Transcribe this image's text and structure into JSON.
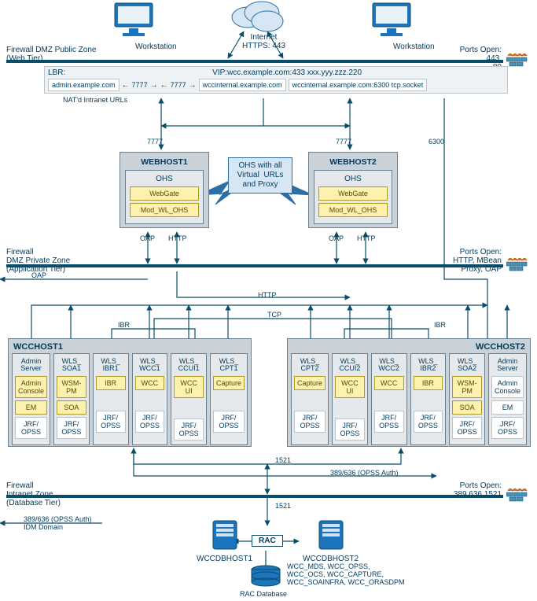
{
  "internet": {
    "label": "Internet",
    "protocol": "HTTPS: 443"
  },
  "workstation_left": "Workstation",
  "workstation_right": "Workstation",
  "fw1": {
    "left_label": "Firewall DMZ Public Zone\n(Web Tier)",
    "right_label": "Ports Open:\n443,\n80"
  },
  "lbr": {
    "prefix": "LBR:",
    "vip": "VIP:wcc.example.com:433  xxx.yyy.zzz.220",
    "url1": "admin.example.com",
    "url2": "wccinternal.example.com",
    "url3": "wccinternal.example.com:6300 tcp.socket",
    "nat": "NAT'd Intranet URLs",
    "p7777_a": "7777",
    "p7777_b": "7777"
  },
  "ports": {
    "p7777_l": "7777",
    "p7777_r": "7777",
    "p6300": "6300"
  },
  "ohs_center": "OHS with all\nVirtual  URLs\nand Proxy",
  "webhost1": {
    "title": "WEBHOST1",
    "ohs": "OHS",
    "webgate": "WebGate",
    "mod": "Mod_WL_OHS"
  },
  "webhost2": {
    "title": "WEBHOST2",
    "ohs": "OHS",
    "webgate": "WebGate",
    "mod": "Mod_WL_OHS"
  },
  "web_proto": {
    "oap1": "OAP",
    "http1": "HTTP",
    "oap2": "OAP",
    "http2": "HTTP"
  },
  "fw2": {
    "left_label": "Firewall\nDMZ Private Zone\n(Application Tier)",
    "right_label": "Ports Open:\nHTTP, MBean\nProxy, OAP",
    "oap": "OAP",
    "http": "HTTP",
    "tcp": "TCP",
    "ibr_l": "IBR",
    "ibr_r": "IBR"
  },
  "wcchost1": {
    "title": "WCCHOST1",
    "cols": [
      {
        "ttl": "Admin\nServer",
        "chips": [
          {
            "t": "Admin\nConsole",
            "y": true
          },
          {
            "t": "EM",
            "y": true
          },
          {
            "t": "JRF/\nOPSS",
            "y": false
          }
        ]
      },
      {
        "ttl": "WLS_\nSOA1",
        "chips": [
          {
            "t": "WSM-\nPM",
            "y": true
          },
          {
            "t": "SOA",
            "y": true
          },
          {
            "t": "JRF/\nOPSS",
            "y": false
          }
        ]
      },
      {
        "ttl": "WLS_\nIBR1",
        "chips": [
          {
            "t": "IBR",
            "y": true
          },
          {
            "t": "",
            "y": null
          },
          {
            "t": "JRF/\nOPSS",
            "y": false
          }
        ]
      },
      {
        "ttl": "WLS_\nWCC1",
        "chips": [
          {
            "t": "WCC",
            "y": true
          },
          {
            "t": "",
            "y": null
          },
          {
            "t": "JRF/\nOPSS",
            "y": false
          }
        ]
      },
      {
        "ttl": "WLS_\nCCUI1",
        "chips": [
          {
            "t": "WCC\nUI",
            "y": true
          },
          {
            "t": "",
            "y": null
          },
          {
            "t": "JRF/\nOPSS",
            "y": false
          }
        ]
      },
      {
        "ttl": "WLS_\nCPT1",
        "chips": [
          {
            "t": "Capture",
            "y": true
          },
          {
            "t": "",
            "y": null
          },
          {
            "t": "JRF/\nOPSS",
            "y": false
          }
        ]
      }
    ]
  },
  "wcchost2": {
    "title": "WCCHOST2",
    "cols": [
      {
        "ttl": "WLS_\nCPT2",
        "chips": [
          {
            "t": "Capture",
            "y": true
          },
          {
            "t": "",
            "y": null
          },
          {
            "t": "JRF/\nOPSS",
            "y": false
          }
        ]
      },
      {
        "ttl": "WLS_\nCCUI2",
        "chips": [
          {
            "t": "WCC\nUI",
            "y": true
          },
          {
            "t": "",
            "y": null
          },
          {
            "t": "JRF/\nOPSS",
            "y": false
          }
        ]
      },
      {
        "ttl": "WLS_\nWCC2",
        "chips": [
          {
            "t": "WCC",
            "y": true
          },
          {
            "t": "",
            "y": null
          },
          {
            "t": "JRF/\nOPSS",
            "y": false
          }
        ]
      },
      {
        "ttl": "WLS_\nIBR2",
        "chips": [
          {
            "t": "IBR",
            "y": true
          },
          {
            "t": "",
            "y": null
          },
          {
            "t": "JRF/\nOPSS",
            "y": false
          }
        ]
      },
      {
        "ttl": "WLS_\nSOA2",
        "chips": [
          {
            "t": "WSM-\nPM",
            "y": true
          },
          {
            "t": "SOA",
            "y": true
          },
          {
            "t": "JRF/\nOPSS",
            "y": false
          }
        ]
      },
      {
        "ttl": "Admin\nServer",
        "chips": [
          {
            "t": "Admin\nConsole",
            "y": false
          },
          {
            "t": "EM",
            "y": false
          },
          {
            "t": "JRF/\nOPSS",
            "y": false
          }
        ]
      }
    ]
  },
  "midports": {
    "p1521": "1521",
    "opss": "389/636 (OPSS Auth)"
  },
  "fw3": {
    "left_label": "Firewall\nIntranet Zone\n(Database Tier)",
    "right_label": "Ports Open:\n389,636,1521",
    "p1521": "1521"
  },
  "idm": "389/636 (OPSS Auth)\nIDM Domain",
  "db": {
    "h1": "WCCDBHOST1",
    "h2": "WCCDBHOST2",
    "rac": "RAC",
    "racdb": "RAC Database",
    "schemas": "WCC_MDS, WCC_OPSS,\nWCC_OCS, WCC_CAPTURE,\nWCC_SOAINFRA, WCC_ORASDPM"
  }
}
